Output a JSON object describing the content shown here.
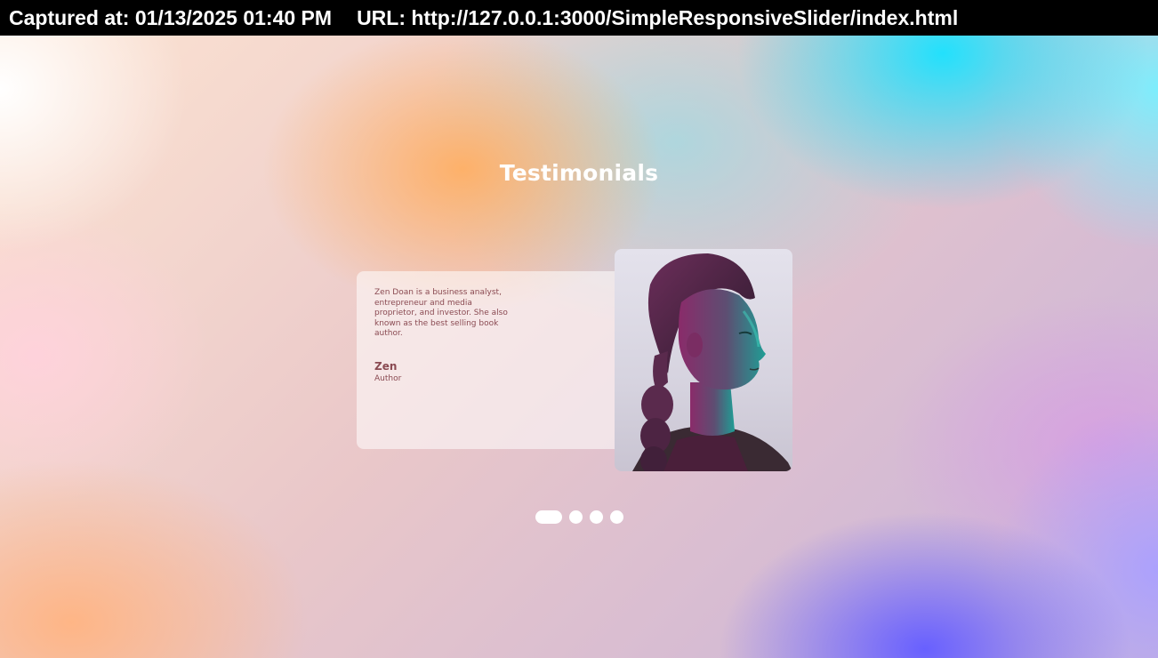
{
  "capture": {
    "captured_at": "Captured at: 01/13/2025 01:40 PM",
    "url": "URL: http://127.0.0.1:3000/SimpleResponsiveSlider/index.html"
  },
  "page": {
    "heading": "Testimonials"
  },
  "slider": {
    "active_index": 0,
    "total_slides": 4,
    "slides": [
      {
        "quote": "Zen Doan is a business analyst, entrepreneur and media proprietor, and investor. She also known as the best selling book author.",
        "name": "Zen",
        "role": "Author",
        "photo_icon": "portrait-woman-icon"
      }
    ],
    "dots": [
      {
        "active": true
      },
      {
        "active": false
      },
      {
        "active": false
      },
      {
        "active": false
      }
    ]
  },
  "colors": {
    "text_accent": "#8a4a52",
    "heading": "#ffffff",
    "card_bg": "rgba(255,255,255,0.55)",
    "dot": "#ffffff"
  }
}
